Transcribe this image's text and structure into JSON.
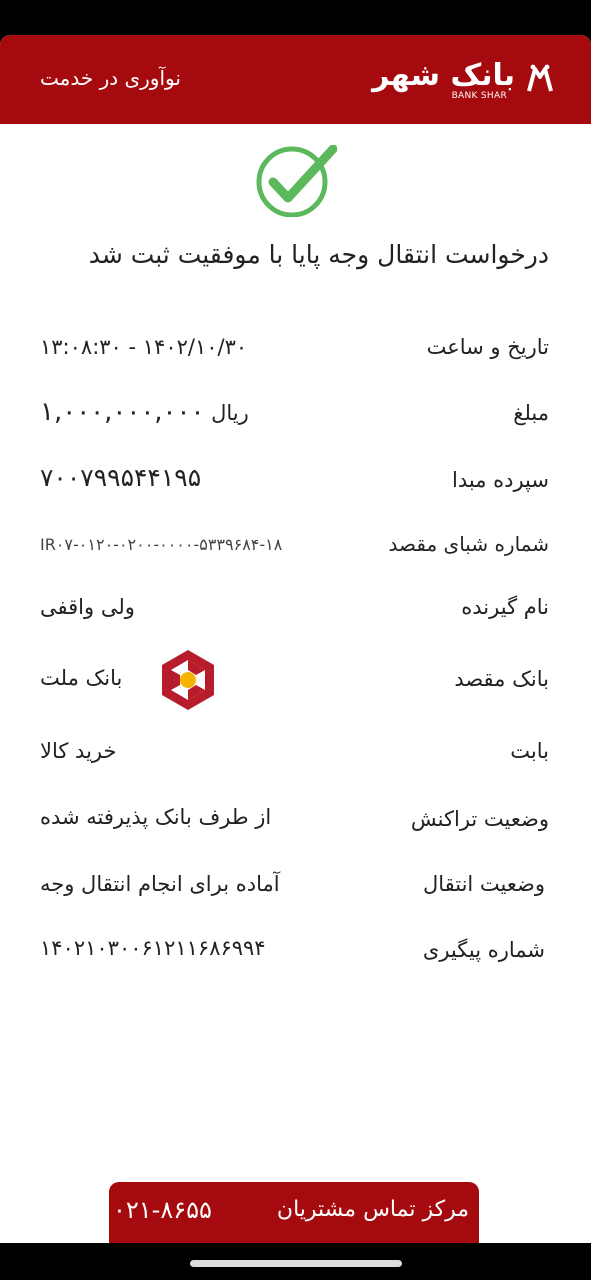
{
  "header": {
    "slogan": "نوآوری در خدمت",
    "logo_fa": "بانک شهر",
    "logo_en": "BANK SHAR",
    "color": "#a50a0f"
  },
  "status": {
    "icon": "success-check-icon",
    "color": "#5cb85c",
    "title": "درخواست انتقال وجه پایا با موفقیت ثبت  شد"
  },
  "details": {
    "datetime": {
      "label": "تاریخ و ساعت",
      "value": "۱۴۰۲/۱۰/۳۰  -  ۱۳:۰۸:۳۰"
    },
    "amount": {
      "label": "مبلغ",
      "value": "۱,۰۰۰,۰۰۰,۰۰۰",
      "unit": "ریال"
    },
    "source_deposit": {
      "label": "سپرده مبدا",
      "value": "۷۰۰۷۹۹۵۴۴۱۹۵"
    },
    "dest_sheba": {
      "label": "شماره شبای مقصد",
      "value": "IR۰۷-۰۱۲۰-۰۲۰۰-۰۰۰۰-۵۳۳۹۶۸۴-۱۸"
    },
    "receiver": {
      "label": "نام  گیرنده",
      "value": "ولی واقفی"
    },
    "dest_bank": {
      "label": "بانک  مقصد",
      "value": "بانک ملت",
      "icon": "mellat-bank-logo-icon"
    },
    "purpose": {
      "label": "بابت",
      "value": "خرید کالا"
    },
    "transaction_status": {
      "label": "وضعیت  تراکنش",
      "value": "از طرف بانک پذیرفته شده"
    },
    "transfer_status": {
      "label": "وضعیت  انتقال",
      "value": "آماده  برای انجام انتقال وجه"
    },
    "tracking": {
      "label": "شماره  پیگیری",
      "value": "۱۴۰۲۱۰۳۰۰۶۱۲۱۱۶۸۶۹۹۴"
    }
  },
  "footer": {
    "label": "مرکز  تماس مشتریان",
    "phone": "۰۲۱-۸۶۵۵"
  }
}
